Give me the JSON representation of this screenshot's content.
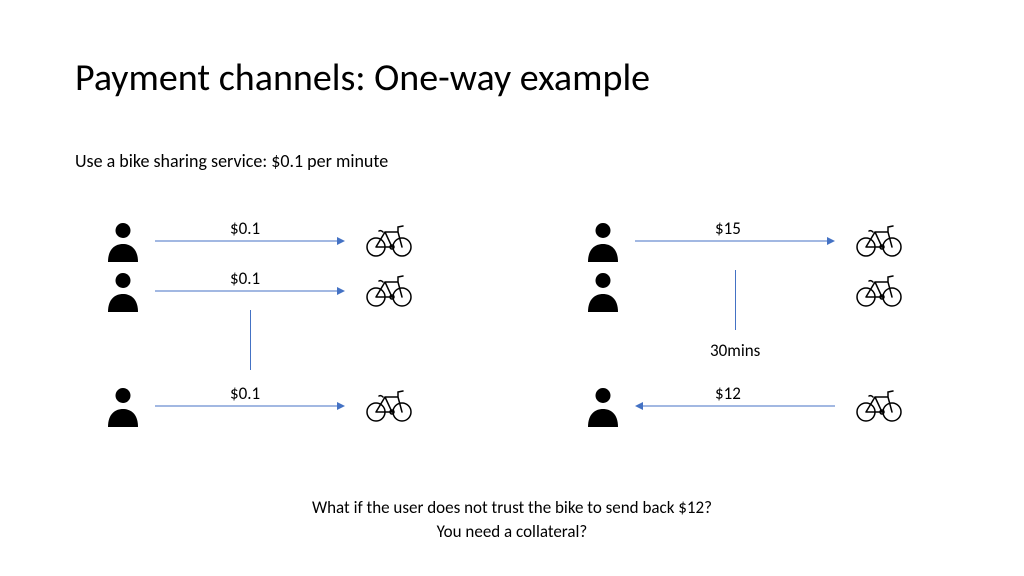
{
  "title": "Payment channels: One-way example",
  "subtitle": "Use a bike sharing service: $0.1 per minute",
  "left": {
    "row1": "$0.1",
    "row2": "$0.1",
    "row3": "$0.1"
  },
  "right": {
    "row1": "$15",
    "mid": "30mins",
    "row3": "$12"
  },
  "footer": {
    "line1": "What if the user does not trust the bike to send back $12?",
    "line2": "You need a collateral?"
  }
}
